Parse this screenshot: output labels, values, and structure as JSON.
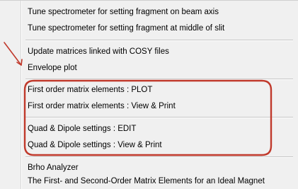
{
  "menu": {
    "items": [
      {
        "label": "Tune spectrometer for setting fragment on beam axis"
      },
      {
        "label": "Tune spectrometer for setting fragment at middle of slit"
      },
      {
        "label": "Update matrices linked with COSY files"
      },
      {
        "label": "Envelope plot"
      },
      {
        "label": "First order matrix elements : PLOT"
      },
      {
        "label": "First order matrix elements : View & Print"
      },
      {
        "label": "Quad & Dipole settings : EDIT"
      },
      {
        "label": "Quad & Dipole settings : View & Print"
      },
      {
        "label": "Brho Analyzer"
      },
      {
        "label": "The First- and Second-Order Matrix Elements for an Ideal Magnet"
      }
    ]
  },
  "annotation": {
    "color": "#c0392b"
  }
}
